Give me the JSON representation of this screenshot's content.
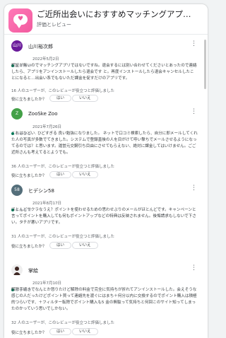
{
  "app": {
    "title": "ご近所出会いにおすすめマッチングアプリ-ご近所フ...",
    "subtitle": "評価とレビュー",
    "icon_name": "app-icon",
    "accent": "#f25a9e"
  },
  "reviews": [
    {
      "name": "山川裕次郎",
      "avatar_text": "山川",
      "avatar_color": "#6a1b9a",
      "rating": 1,
      "date": "2022年5月2日",
      "body": "認証が無いのでマッチングアプリではないですね。退会するには別い合わせてくださいとあったので連絡したら、アプリをアンインストールしたら退会です と。再度インストールしたら退会キャンセルしたことになると…出会い系でもないただ課金を促すだけのアプリです。",
      "helpful": "16 人のユーザーが、このレビューが役立つと評価しました",
      "question": "役に立ちましたか？",
      "yes": "はい",
      "no": "いいえ"
    },
    {
      "name": "ZooSke Zoo",
      "avatar_text": "Z",
      "avatar_color": "#43a047",
      "rating": 1,
      "date": "2021年7月26日",
      "body": "これはひどい. ひどすぎる 良い勉強になりました。 ネットで口コミ検索したら、自分に即メールしてくれた人の写真が多数でてきました。システムで登録直後の人を目がけて呼い撃ちでメールさせるようになってるのでは？と思います。運営元交鋼引ち目由にさせてもらえない、絶対に課金してはいけません。ごご近所さんも考えてるとようでも。",
      "helpful": "36 人のユーザーが、このレビューが役立つと評価しました",
      "question": "役に立ちましたか？",
      "yes": "はい",
      "no": "いいえ"
    },
    {
      "name": "ヒデシン58",
      "avatar_text": "58",
      "avatar_color": "#546e7a",
      "rating": 1,
      "date": "2021年8月17日",
      "body": "ほとんどサクラなうえ？ポイントを使わせるための思わせぶりのメールがほとんどです。キャンペーンと言ってポイントを購入しても何もポイントアップなどの特典は反映されません。後悔請求もしないで下さい。タチが悪いアプリです。",
      "helpful": "31 人のユーザーが、このレビューが役立つと評価しました",
      "question": "役に立ちましたか？",
      "yes": "はい",
      "no": "いいえ"
    },
    {
      "name": "掌絵",
      "avatar_text": "",
      "avatar_color": "#8d6e63",
      "rating": 1,
      "date": "2021年7月10日",
      "body": "解除手続きでなんとか怒りたけど解除の料金で完全に気持ちが折れてアンインストールした。会えそうな感じの人だったけどポイント買って連絡先を渡ぐにはまち＋何分以内に交換するのでポイント購入は積極的つらいです、＋フィルター転除でポイント購入も5 金の無駄って気持ちと何回このサイト知ってしまったのかっていう思いでしかない。",
      "helpful": "32 人のユーザーが、このレビューが役立つと評価しました",
      "question": "役に立ちましたか？",
      "yes": "はい",
      "no": "いいえ"
    }
  ]
}
